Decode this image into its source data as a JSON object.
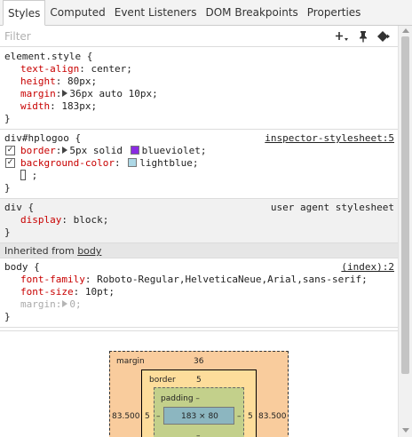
{
  "tabs": [
    "Styles",
    "Computed",
    "Event Listeners",
    "DOM Breakpoints",
    "Properties"
  ],
  "active_tab": "Styles",
  "filter": {
    "placeholder": "Filter",
    "value": ""
  },
  "toolbar_icons": [
    "add-rule-icon",
    "pin-icon",
    "toggle-element-state-icon"
  ],
  "rules": {
    "element_style": {
      "selector": "element.style {",
      "decls": [
        {
          "prop": "text-align",
          "value": "center;"
        },
        {
          "prop": "height",
          "value": "80px;"
        },
        {
          "prop": "margin",
          "value": "36px auto 10px;"
        },
        {
          "prop": "width",
          "value": "183px;"
        }
      ],
      "close": "}"
    },
    "hplogoo": {
      "selector": "div#hplogoo {",
      "source": "inspector-stylesheet:5",
      "decls": [
        {
          "prop": "border",
          "value": "5px solid",
          "color_name": "blueviolet;",
          "swatch": "#8a2be2",
          "checked": true
        },
        {
          "prop": "background-color",
          "value": "",
          "color_name": "lightblue;",
          "swatch": "#add8e6",
          "checked": true
        }
      ],
      "editing": ";",
      "close": "}"
    },
    "div_ua": {
      "selector": "div {",
      "source": "user agent stylesheet",
      "decls": [
        {
          "prop": "display",
          "value": "block;"
        }
      ],
      "close": "}"
    },
    "inherited": {
      "label": "Inherited from",
      "link": "body"
    },
    "body": {
      "selector": "body {",
      "source": "(index):2",
      "decls": [
        {
          "prop": "font-family",
          "value": "Roboto-Regular,HelveticaNeue,Arial,sans-serif;"
        },
        {
          "prop": "font-size",
          "value": "10pt;"
        },
        {
          "prop": "margin",
          "value": "0;",
          "overridden": true
        }
      ],
      "close": "}"
    }
  },
  "box_model": {
    "margin_label": "margin",
    "margin_top": "36",
    "margin_left": "83.500",
    "margin_right": "83.500",
    "border_label": "border",
    "border_value": "5",
    "border_left": "5",
    "border_right": "5",
    "padding_label": "padding –",
    "padding_left": "–",
    "padding_right": "–",
    "padding_bottom": "–",
    "content": "183 × 80"
  },
  "colors": {
    "accent_prop": "#c80000",
    "margin_box": "#f9cc9d",
    "border_box": "#fddd9b",
    "padding_box": "#c3d08b",
    "content_box": "#8cb6c0"
  }
}
